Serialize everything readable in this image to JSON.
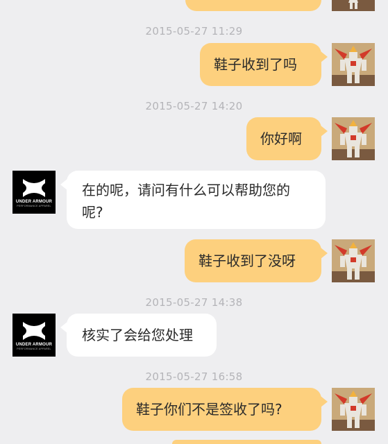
{
  "chat": {
    "timestamps": [
      "2015-05-27 11:29",
      "2015-05-27 14:20",
      "2015-05-27 14:38",
      "2015-05-27 16:58"
    ],
    "messages": [
      {
        "sender": "me",
        "text": "鞋子收到了吗"
      },
      {
        "sender": "me",
        "text": "你好啊"
      },
      {
        "sender": "other",
        "line1": "在的呢，请问有什么可以帮助您的",
        "line2": "呢?"
      },
      {
        "sender": "me",
        "text": "鞋子收到了没呀"
      },
      {
        "sender": "other",
        "text": "核实了会给您处理"
      },
      {
        "sender": "me",
        "text": "鞋子你们不是签收了吗?"
      }
    ]
  },
  "avatars": {
    "me": {
      "icon": "robot-figure-avatar-icon",
      "colors": [
        "#c8a878",
        "#d43a2a",
        "#e8e4dc",
        "#f0b040"
      ]
    },
    "other": {
      "icon": "under-armour-logo-icon",
      "brand_text": "UNDER ARMOUR",
      "tagline": "PERFORMANCE APPAREL"
    }
  },
  "colors": {
    "background": "#eeeef0",
    "my_bubble": "#fdd07e",
    "their_bubble": "#ffffff",
    "timestamp": "#b4b4b8"
  }
}
